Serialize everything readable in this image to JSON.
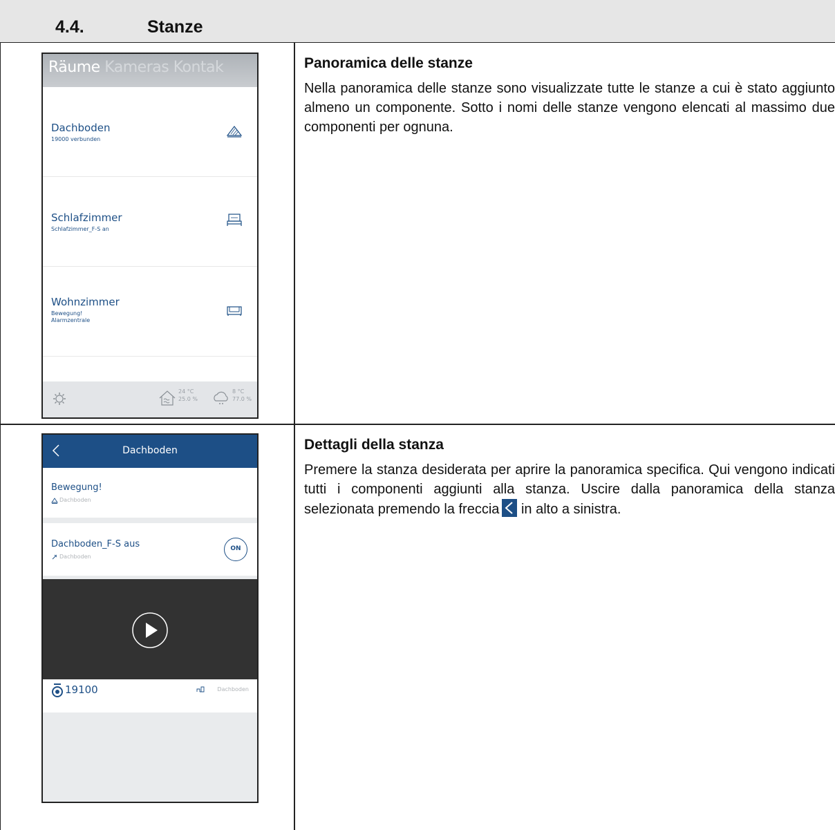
{
  "section": {
    "number": "4.4.",
    "title": "Stanze"
  },
  "row1": {
    "heading": "Panoramica delle stanze",
    "text": "Nella panoramica delle stanze sono visualizzate tutte le stanze a cui è stato aggiunto almeno un componente. Sotto i nomi delle stanze vengono elencati al massimo due componenti per ognuna."
  },
  "row2": {
    "heading": "Dettagli della stanza",
    "text_before_icon": "Premere la stanza desiderata per aprire la panoramica specifica. Qui vengono indicati tutti i componenti aggiunti alla stanza. Uscire dalla panoramica della stanza selezionata premendo la freccia",
    "text_after_icon": "in alto a sinistra."
  },
  "phone1": {
    "tabs": [
      "Räume",
      "Kameras",
      "Kontak"
    ],
    "rooms": [
      {
        "name": "Dachboden",
        "lines": [
          "19000 verbunden"
        ],
        "icon": "attic-icon"
      },
      {
        "name": "Schlafzimmer",
        "lines": [
          "Schlafzimmer_F-S an"
        ],
        "icon": "bed-icon"
      },
      {
        "name": "Wohnzimmer",
        "lines": [
          "Bewegung!",
          "Alarmzentrale"
        ],
        "icon": "sofa-icon"
      }
    ],
    "indoor": {
      "temp": "24 °C",
      "humidity": "25.0 %"
    },
    "outdoor": {
      "temp": "8 °C",
      "humidity": "77.0 %"
    }
  },
  "phone2": {
    "title": "Dachboden",
    "cards": [
      {
        "name": "Bewegung!",
        "room": "Dachboden"
      },
      {
        "name": "Dachboden_F-S aus",
        "room": "Dachboden",
        "button": "ON"
      }
    ],
    "camera": {
      "name": "19100",
      "room": "Dachboden"
    }
  },
  "colors": {
    "brand_blue": "#1d4f86",
    "header_gray": "#e6e6e6",
    "video_bg": "#323232"
  }
}
